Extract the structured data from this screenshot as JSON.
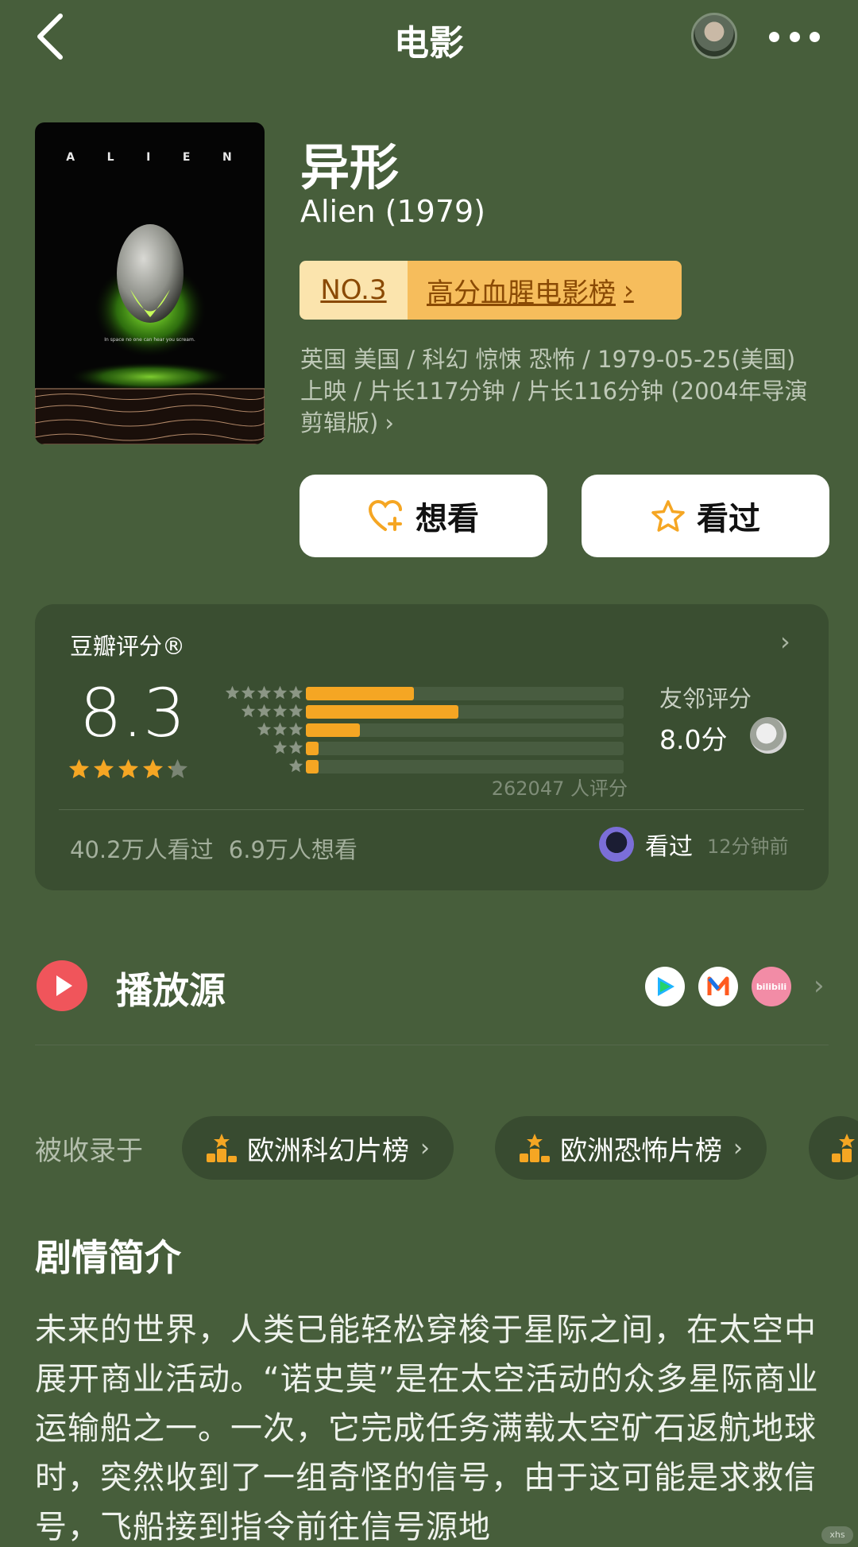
{
  "header": {
    "title": "电影"
  },
  "movie": {
    "title_cn": "异形",
    "title_en": "Alien (1979)",
    "poster": {
      "title": "ALIEN",
      "title_letters": [
        "A",
        "L",
        "I",
        "E",
        "N"
      ],
      "tagline": "In space no one can hear you scream."
    },
    "rank_no": "NO.3",
    "rank_list": "高分血腥电影榜",
    "meta": "英国 美国 / 科幻 惊悚 恐怖 / 1979-05-25(美国) 上映 / 片长117分钟 / 片长116分钟 (2004年导演剪辑版)"
  },
  "actions": {
    "want_label": "想看",
    "watched_label": "看过"
  },
  "rating": {
    "label": "豆瓣评分®",
    "score": "8.3",
    "star_fill": 4.2,
    "distribution": [
      {
        "stars": 5,
        "fraction": 0.34
      },
      {
        "stars": 4,
        "fraction": 0.48
      },
      {
        "stars": 3,
        "fraction": 0.17
      },
      {
        "stars": 2,
        "fraction": 0.04
      },
      {
        "stars": 1,
        "fraction": 0.04
      }
    ],
    "count_text": "262047 人评分",
    "neighbor_label": "友邻评分",
    "neighbor_score": "8.0分",
    "stats_text": "40.2万人看过   6.9万人想看",
    "friend_action": "看过",
    "friend_time": "12分钟前"
  },
  "play": {
    "title": "播放源",
    "sources": [
      "tencent-video-icon",
      "mgtv-icon",
      "bilibili-icon"
    ],
    "bilibili_label": "bilibili"
  },
  "collections": {
    "label": "被收录于",
    "items": [
      "欧洲科幻片榜",
      "欧洲恐怖片榜"
    ]
  },
  "synopsis": {
    "title": "剧情简介",
    "text": "未来的世界，人类已能轻松穿梭于星际之间，在太空中展开商业活动。“诺史莫”是在太空活动的众多星际商业运输船之一。一次，它完成任务满载太空矿石返航地球时，突然收到了一组奇怪的信号，由于这可能是求救信号，飞船接到指令前往信号源地"
  },
  "colors": {
    "background": "#475e3b",
    "card": "#3a4e31",
    "accent": "#f5a623",
    "rank_light": "#fbe4ad",
    "rank_dark": "#f6bd5c",
    "play_red": "#f0555b"
  },
  "watermark": "xhs"
}
